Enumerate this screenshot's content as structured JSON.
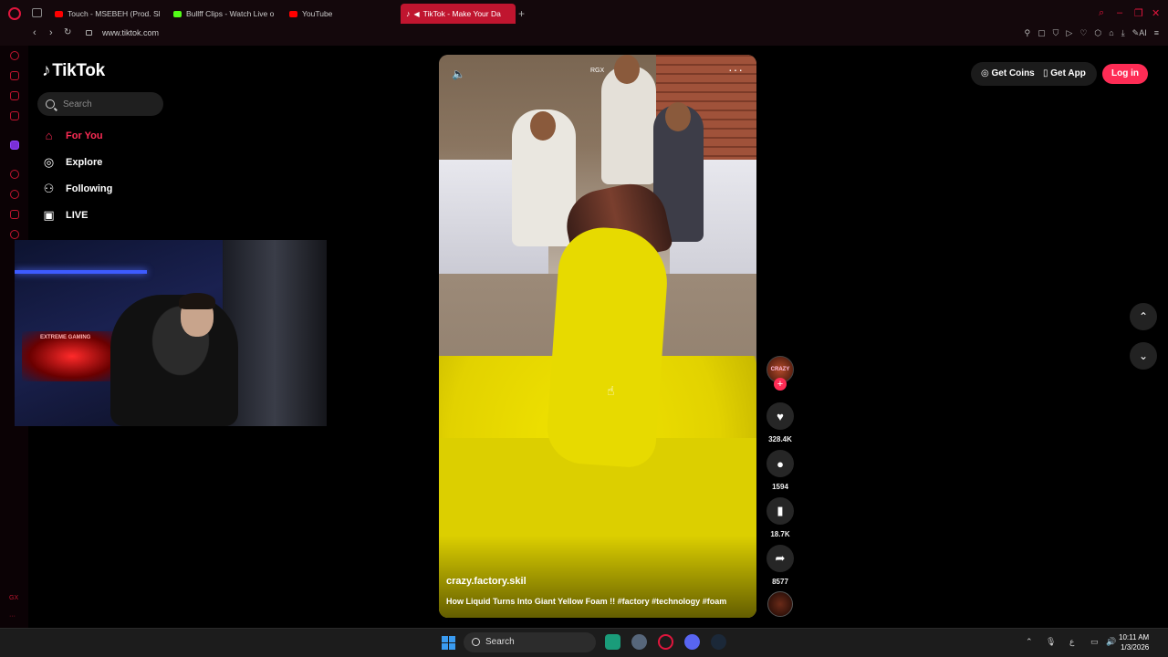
{
  "browser": {
    "tabs": [
      {
        "label": "Touch - MSEBEH (Prod. Sl",
        "favicon_color": "#ff0000"
      },
      {
        "label": "Bullff Clips - Watch Live o",
        "favicon_color": "#53fc18"
      },
      {
        "label": "YouTube",
        "favicon_color": "#ff0000"
      },
      {
        "label": "TikTok - Make Your Da",
        "favicon_color": "#ffffff",
        "active": true
      }
    ],
    "url": "www.tiktok.com",
    "toolbar_right_label": "AI"
  },
  "opera_sidebar": {
    "gx_label": "GX"
  },
  "tiktok": {
    "logo": "TikTok",
    "search_placeholder": "Search",
    "nav": [
      {
        "label": "For You",
        "icon": "home-icon",
        "active": true
      },
      {
        "label": "Explore",
        "icon": "compass-icon"
      },
      {
        "label": "Following",
        "icon": "following-icon"
      },
      {
        "label": "LIVE",
        "icon": "live-tv-icon"
      }
    ],
    "header": {
      "get_coins": "Get Coins",
      "get_app": "Get App",
      "login": "Log in"
    },
    "video": {
      "watermark": "RGX",
      "author": "crazy.factory.skil",
      "caption": "How Liquid Turns Into Giant Yellow Foam !! #factory #technology #foam",
      "avatar_text": "CRAZY",
      "likes": "328.4K",
      "comments": "1594",
      "saves": "18.7K",
      "shares": "8577"
    }
  },
  "webcam": {
    "sign_text": "EXTREME GAMING"
  },
  "taskbar": {
    "search_label": "Search",
    "time": "10:11 AM",
    "date": "1/3/2026",
    "lang": "ع"
  },
  "colors": {
    "accent": "#fe2c55",
    "opera_red": "#c0152f"
  }
}
